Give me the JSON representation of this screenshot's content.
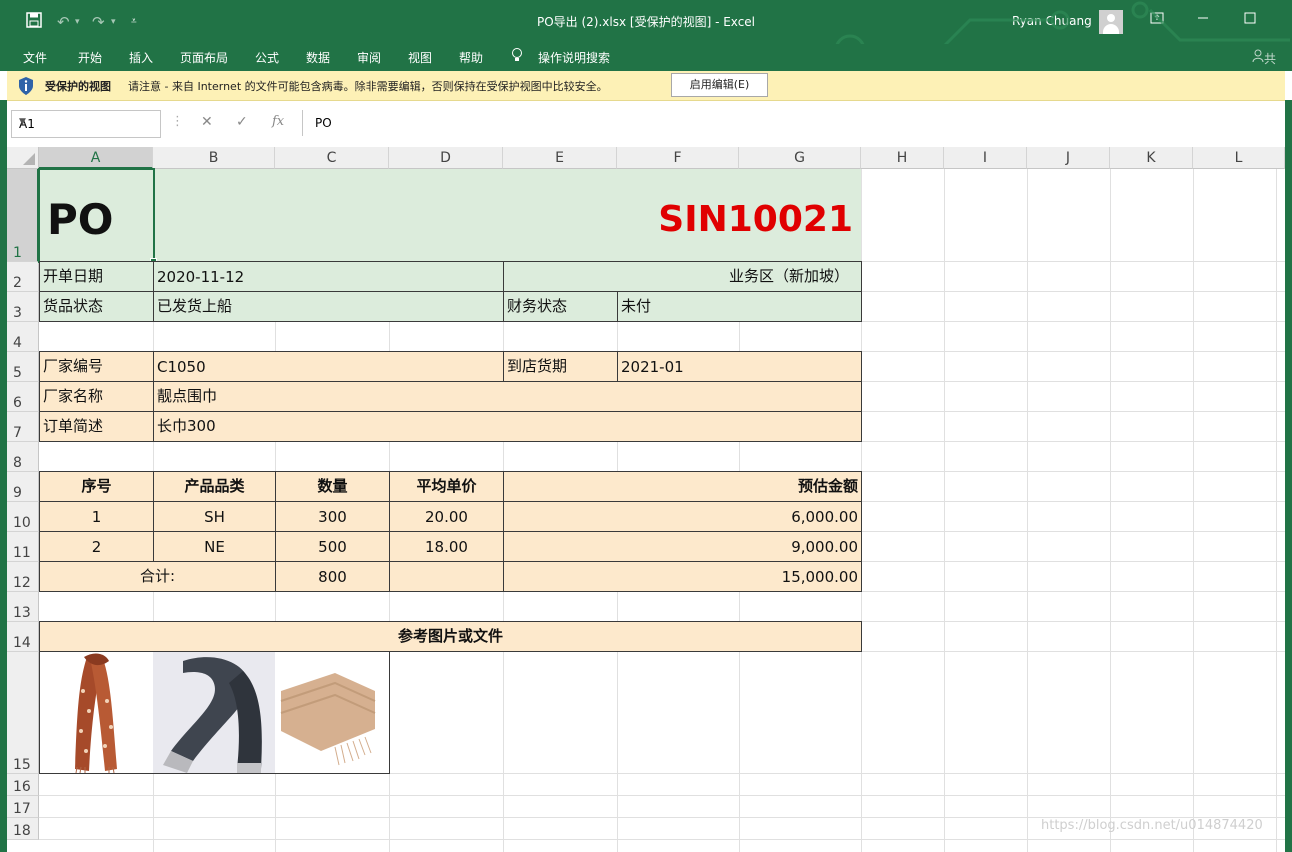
{
  "window": {
    "title": "PO导出 (2).xlsx  [受保护的视图]  -  Excel",
    "user": "Ryan Chuang",
    "share_label": "共"
  },
  "ribbon_tabs": [
    "文件",
    "开始",
    "插入",
    "页面布局",
    "公式",
    "数据",
    "审阅",
    "视图",
    "帮助",
    "操作说明搜索"
  ],
  "protected_view": {
    "title": "受保护的视图",
    "message": "请注意 - 来自 Internet 的文件可能包含病毒。除非需要编辑，否则保持在受保护视图中比较安全。",
    "button": "启用编辑(E)"
  },
  "formula_bar": {
    "name_box": "A1",
    "fx": "fx",
    "value": "PO"
  },
  "columns": [
    "A",
    "B",
    "C",
    "D",
    "E",
    "F",
    "G",
    "H",
    "I",
    "J",
    "K",
    "L"
  ],
  "rows": [
    "1",
    "2",
    "3",
    "4",
    "5",
    "6",
    "7",
    "8",
    "9",
    "10",
    "11",
    "12",
    "13",
    "14",
    "15",
    "16",
    "17",
    "18"
  ],
  "sheet": {
    "po_label": "PO",
    "po_number": "SIN10021",
    "order_date_label": "开单日期",
    "order_date": "2020-11-12",
    "region": "业务区（新加坡）",
    "goods_status_label": "货品状态",
    "goods_status": "已发货上船",
    "finance_status_label": "财务状态",
    "finance_status": "未付",
    "vendor_code_label": "厂家编号",
    "vendor_code": "C1050",
    "arrival_label": "到店货期",
    "arrival": "2021-01",
    "vendor_name_label": "厂家名称",
    "vendor_name": "靓点围巾",
    "order_desc_label": "订单简述",
    "order_desc": "长巾300",
    "table_headers": [
      "序号",
      "产品品类",
      "数量",
      "平均单价",
      "预估金额"
    ],
    "table_rows": [
      {
        "no": "1",
        "category": "SH",
        "qty": "300",
        "price": "20.00",
        "amount": "6,000.00"
      },
      {
        "no": "2",
        "category": "NE",
        "qty": "500",
        "price": "18.00",
        "amount": "9,000.00"
      }
    ],
    "total_label": "合计:",
    "total_qty": "800",
    "total_amount": "15,000.00",
    "ref_label": "参考图片或文件"
  },
  "colors": {
    "excel_green": "#217346",
    "header_green": "#dcecdc",
    "peach": "#fde9cc",
    "po_red": "#e00000"
  },
  "watermark": "https://blog.csdn.net/u014874420"
}
